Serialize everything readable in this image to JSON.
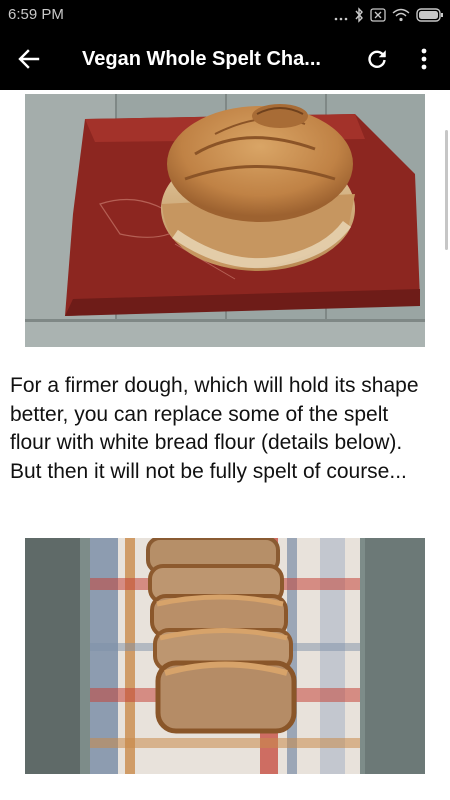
{
  "status_bar": {
    "time": "6:59 PM",
    "icons": [
      "dots-icon",
      "bluetooth-icon",
      "sim-icon",
      "wifi-icon",
      "battery-icon"
    ]
  },
  "app_bar": {
    "title": "Vegan Whole Spelt Cha...",
    "back_icon": "arrow-left-icon",
    "refresh_icon": "refresh-icon",
    "more_icon": "more-vert-icon"
  },
  "article": {
    "paragraph": "For a firmer dough, which will hold its shape better, you can replace some of the spelt flour with white bread flour (details below). But then it will not be fully spelt of course..."
  },
  "colors": {
    "toolbar": "#000000",
    "text": "#111111",
    "background": "#ffffff"
  }
}
